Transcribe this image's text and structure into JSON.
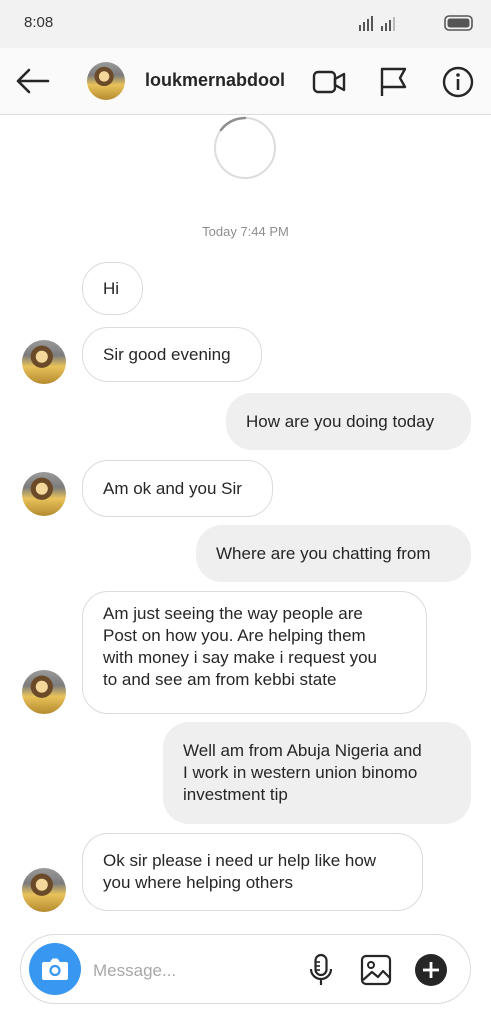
{
  "status_bar": {
    "time": "8:08"
  },
  "header": {
    "username": "loukmernabdool"
  },
  "chat": {
    "timestamp": "Today 7:44 PM",
    "messages": [
      {
        "side": "in",
        "text": "Hi"
      },
      {
        "side": "in",
        "text": "Sir good evening"
      },
      {
        "side": "out",
        "text": "How are you doing today"
      },
      {
        "side": "in",
        "text": "Am ok and you Sir"
      },
      {
        "side": "out",
        "text": "Where are you chatting from"
      },
      {
        "side": "in",
        "lines": [
          "Am just seeing the way people are",
          "Post on how you. Are helping them",
          "with money i say make i request you",
          "to and see am from kebbi state"
        ]
      },
      {
        "side": "out",
        "lines": [
          "Well am from Abuja Nigeria and",
          "I work in western union binomo",
          "investment tip"
        ]
      },
      {
        "side": "in",
        "lines": [
          "Ok sir please i need ur help like how",
          "you where helping others"
        ]
      }
    ]
  },
  "composer": {
    "placeholder": "Message..."
  },
  "icons": {
    "back": "arrow-left-icon",
    "video": "video-call-icon",
    "flag": "flag-icon",
    "info": "info-icon",
    "camera": "camera-icon",
    "mic": "microphone-icon",
    "gallery": "image-icon",
    "add": "plus-icon"
  },
  "colors": {
    "accent": "#3897f0",
    "outgoing_bubble": "#efefef",
    "incoming_border": "#dbdbdb"
  }
}
